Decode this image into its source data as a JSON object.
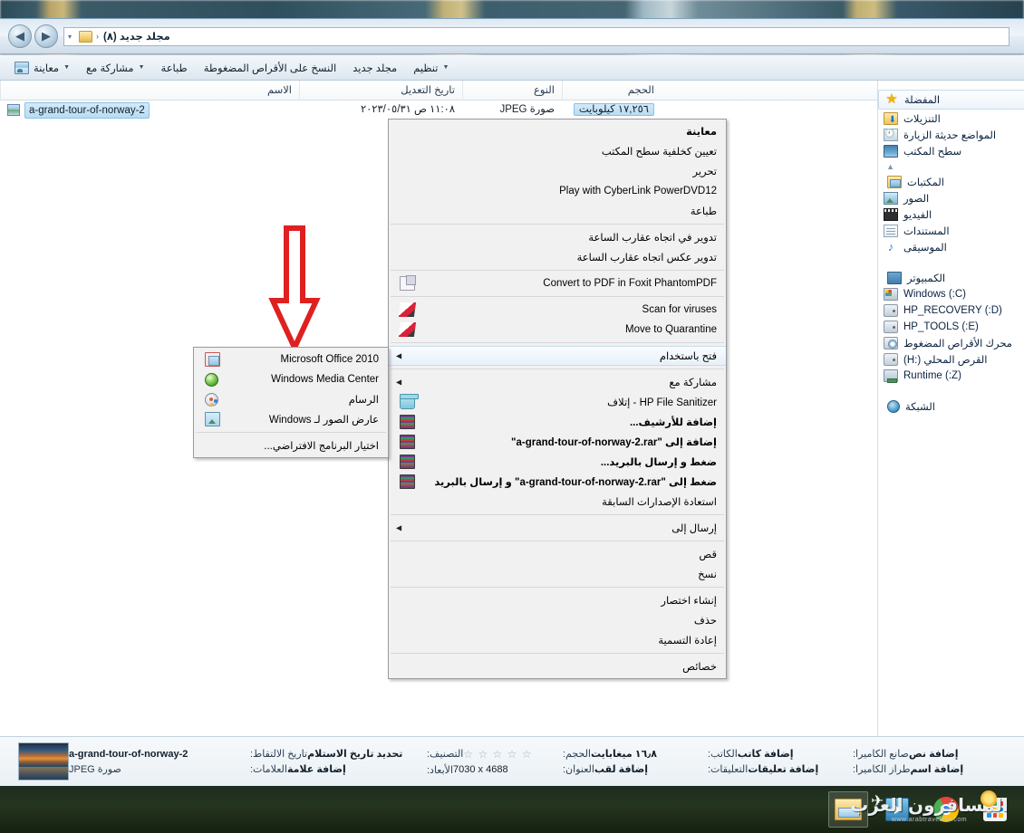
{
  "window": {
    "address": {
      "text": "مجلد جديد (٨)",
      "chevron": "‹",
      "dropdown": "▾",
      "folder_icon": "folder-icon"
    },
    "nav": {
      "back": "◀",
      "forward": "▶"
    }
  },
  "toolbar": {
    "items": [
      {
        "label": "معاينة",
        "icon": "preview-icon",
        "caret": "▼"
      },
      {
        "label": "مشاركة مع",
        "caret": "▼"
      },
      {
        "label": "طباعة"
      },
      {
        "label": "النسخ على الأقراص المضغوطة"
      },
      {
        "label": "مجلد جديد"
      },
      {
        "label": "تنظيم",
        "caret": "▼"
      }
    ]
  },
  "columns": {
    "name": "الاسم",
    "date": "تاريخ التعديل",
    "type": "النوع",
    "size": "الحجم",
    "sort_indicator": "▲"
  },
  "file_row": {
    "name": "a-grand-tour-of-norway-2",
    "date": "١١:٠٨ ص ٣١/‏٠٥/‏٢٠٢٣",
    "type": "صورة JPEG",
    "size": "١٧,٢٥٦ كيلوبايت",
    "icon": "image-thumbnail-icon"
  },
  "navpane": {
    "favorites": {
      "label": "المفضلة",
      "icon": "star-icon"
    },
    "favorites_items": [
      {
        "label": "التنزيلات",
        "icon": "downloads-icon"
      },
      {
        "label": "المواضع حديثة الزيارة",
        "icon": "recent-places-icon"
      },
      {
        "label": "سطح المكتب",
        "icon": "desktop-icon"
      }
    ],
    "libraries": {
      "label": "المكتبات",
      "icon": "library-icon"
    },
    "libraries_items": [
      {
        "label": "الصور",
        "icon": "pictures-icon"
      },
      {
        "label": "الفيديو",
        "icon": "videos-icon"
      },
      {
        "label": "المستندات",
        "icon": "documents-icon"
      },
      {
        "label": "الموسيقى",
        "icon": "music-icon"
      }
    ],
    "computer": {
      "label": "الكمبيوتر",
      "icon": "computer-icon"
    },
    "computer_items": [
      {
        "label": "Windows (:C)",
        "icon": "windows-drive-icon"
      },
      {
        "label": "HP_RECOVERY (:D)",
        "icon": "hard-drive-icon"
      },
      {
        "label": "HP_TOOLS (:E)",
        "icon": "hard-drive-icon"
      },
      {
        "label": "محرك الأقراص المضغوط",
        "icon": "cd-drive-icon"
      },
      {
        "label": "القرص المحلي (:H)",
        "icon": "hard-drive-icon"
      },
      {
        "label": "Runtime (:Z)",
        "icon": "network-drive-icon"
      }
    ],
    "network": {
      "label": "الشبكة",
      "icon": "network-icon"
    }
  },
  "context_menu": {
    "groups": [
      {
        "items": [
          {
            "label": "معاينة",
            "bold": true,
            "icon": null,
            "submenu": false,
            "ltr": false
          },
          {
            "label": "تعيين كخلفية سطح المكتب",
            "bold": false,
            "icon": null,
            "submenu": false,
            "ltr": false
          },
          {
            "label": "تحرير",
            "bold": false,
            "icon": null,
            "submenu": false,
            "ltr": false
          },
          {
            "label": "Play with CyberLink PowerDVD12",
            "bold": false,
            "icon": null,
            "submenu": false,
            "ltr": true
          },
          {
            "label": "طباعة",
            "bold": false,
            "icon": null,
            "submenu": false,
            "ltr": false
          }
        ]
      },
      {
        "items": [
          {
            "label": "تدوير في اتجاه عقارب الساعة",
            "bold": false,
            "icon": null,
            "submenu": false,
            "ltr": false
          },
          {
            "label": "تدوير عكس اتجاه عقارب الساعة",
            "bold": false,
            "icon": null,
            "submenu": false,
            "ltr": false
          }
        ]
      },
      {
        "items": [
          {
            "label": "Convert to PDF in Foxit PhantomPDF",
            "bold": false,
            "icon": "foxit-icon",
            "submenu": false,
            "ltr": true
          }
        ]
      },
      {
        "items": [
          {
            "label": "Scan for viruses",
            "bold": false,
            "icon": "antivirus-icon",
            "submenu": false,
            "ltr": true
          },
          {
            "label": "Move to Quarantine",
            "bold": false,
            "icon": "antivirus-icon",
            "submenu": false,
            "ltr": true
          }
        ]
      },
      {
        "items": [
          {
            "label": "فتح باستخدام",
            "bold": false,
            "icon": null,
            "submenu": true,
            "ltr": false,
            "highlight": true
          }
        ]
      },
      {
        "items": [
          {
            "label": "مشاركة مع",
            "bold": false,
            "icon": null,
            "submenu": true,
            "ltr": false
          },
          {
            "label": "HP File Sanitizer - إتلاف",
            "bold": false,
            "icon": "hp-sanitizer-icon",
            "submenu": false,
            "ltr": false
          },
          {
            "label": "إضافة للأرشيف...",
            "bold": true,
            "icon": "winrar-icon",
            "submenu": false,
            "ltr": false
          },
          {
            "label": "إضافة إلى \"a-grand-tour-of-norway-2.rar\"",
            "bold": true,
            "icon": "winrar-icon",
            "submenu": false,
            "ltr": false
          },
          {
            "label": "ضغط و إرسال بالبريد...",
            "bold": true,
            "icon": "winrar-icon",
            "submenu": false,
            "ltr": false
          },
          {
            "label": "ضغط إلى \"a-grand-tour-of-norway-2.rar\" و إرسال بالبريد",
            "bold": true,
            "icon": "winrar-icon",
            "submenu": false,
            "ltr": false
          },
          {
            "label": "استعادة الإصدارات السابقة",
            "bold": false,
            "icon": null,
            "submenu": false,
            "ltr": false
          }
        ]
      },
      {
        "items": [
          {
            "label": "إرسال إلى",
            "bold": false,
            "icon": null,
            "submenu": true,
            "ltr": false
          }
        ]
      },
      {
        "items": [
          {
            "label": "قص",
            "bold": false,
            "icon": null,
            "submenu": false,
            "ltr": false
          },
          {
            "label": "نسخ",
            "bold": false,
            "icon": null,
            "submenu": false,
            "ltr": false
          }
        ]
      },
      {
        "items": [
          {
            "label": "إنشاء اختصار",
            "bold": false,
            "icon": null,
            "submenu": false,
            "ltr": false
          },
          {
            "label": "حذف",
            "bold": false,
            "icon": null,
            "submenu": false,
            "ltr": false
          },
          {
            "label": "إعادة التسمية",
            "bold": false,
            "icon": null,
            "submenu": false,
            "ltr": false
          }
        ]
      },
      {
        "items": [
          {
            "label": "خصائص",
            "bold": false,
            "icon": null,
            "submenu": false,
            "ltr": false
          }
        ]
      }
    ],
    "submenu_arrow": "◀"
  },
  "open_with_submenu": {
    "items": [
      {
        "label": "Microsoft Office 2010",
        "icon": "office-icon",
        "ltr": true
      },
      {
        "label": "Windows Media Center",
        "icon": "media-center-icon",
        "ltr": true
      },
      {
        "label": "الرسام",
        "icon": "paint-icon",
        "ltr": false
      },
      {
        "label": "عارض الصور لـ Windows",
        "icon": "photo-viewer-icon",
        "ltr": false
      }
    ],
    "choose_default": "اختيار البرنامج الافتراضي..."
  },
  "details_pane": {
    "title": "a-grand-tour-of-norway-2",
    "subtitle": "صورة JPEG",
    "fields": [
      {
        "key": "تاريخ الالتقاط:",
        "value": "تحديد تاريخ الاستلام"
      },
      {
        "key": "العلامات:",
        "value": "إضافة علامة"
      },
      {
        "key": "التصنيف:",
        "value": "☆ ☆ ☆ ☆ ☆",
        "is_stars": true
      },
      {
        "key": "الأبعاد:",
        "value": "7030 x 4688",
        "ltr": true
      },
      {
        "key": "الحجم:",
        "value": "١٦٫٨ ميغابايت"
      },
      {
        "key": "العنوان:",
        "value": "إضافة لقب"
      },
      {
        "key": "الكاتب:",
        "value": "إضافة كاتب"
      },
      {
        "key": "التعليقات:",
        "value": "إضافة تعليقات"
      },
      {
        "key": "صانع الكاميرا:",
        "value": "إضافة نص"
      },
      {
        "key": "طراز الكاميرا:",
        "value": "إضافة اسم"
      }
    ]
  },
  "taskbar": {
    "buttons": [
      {
        "name": "start-menu-button",
        "icon": "windows-start-icon"
      },
      {
        "name": "chrome-button",
        "icon": "chrome-icon"
      },
      {
        "name": "media-player-button",
        "icon": "media-player-icon"
      },
      {
        "name": "explorer-button",
        "icon": "folder-explorer-icon",
        "active": true
      }
    ],
    "watermark": {
      "text": "المسافرون العرب",
      "sub": "www.arabtravelers.com"
    }
  },
  "annotation": {
    "arrow": "down-arrow-annotation",
    "color": "#e02020"
  }
}
